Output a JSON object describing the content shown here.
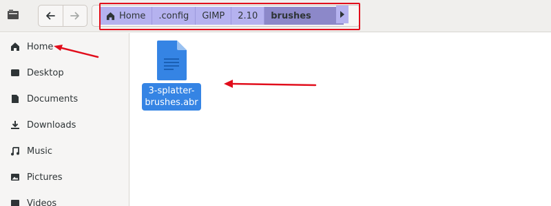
{
  "headerbar": {
    "toolbar_icons": [
      "sidebar-toggle-icon",
      "back-arrow-icon",
      "forward-arrow-icon"
    ],
    "breadcrumb": {
      "items": [
        {
          "label": "Home",
          "icon": "home-icon"
        },
        {
          "label": ".config"
        },
        {
          "label": "GIMP"
        },
        {
          "label": "2.10"
        },
        {
          "label": "brushes",
          "active": true
        }
      ],
      "overflow_icon": "chevron-right-icon"
    }
  },
  "sidebar": {
    "items": [
      {
        "label": "Home",
        "icon": "home-icon"
      },
      {
        "label": "Desktop",
        "icon": "desktop-icon"
      },
      {
        "label": "Documents",
        "icon": "document-icon"
      },
      {
        "label": "Downloads",
        "icon": "download-icon"
      },
      {
        "label": "Music",
        "icon": "music-note-icon"
      },
      {
        "label": "Pictures",
        "icon": "picture-icon"
      },
      {
        "label": "Videos",
        "icon": "video-icon"
      }
    ]
  },
  "main": {
    "files": [
      {
        "name": "3-splatter-brushes.abr",
        "line1": "3-splatter-",
        "line2": "brushes.abr",
        "selected": true,
        "icon": "document-file-icon"
      }
    ]
  },
  "annotations": {
    "color": "#e10d1b",
    "arrows": [
      "arrow-to-home",
      "arrow-to-file"
    ],
    "highlight_box": "breadcrumb"
  }
}
